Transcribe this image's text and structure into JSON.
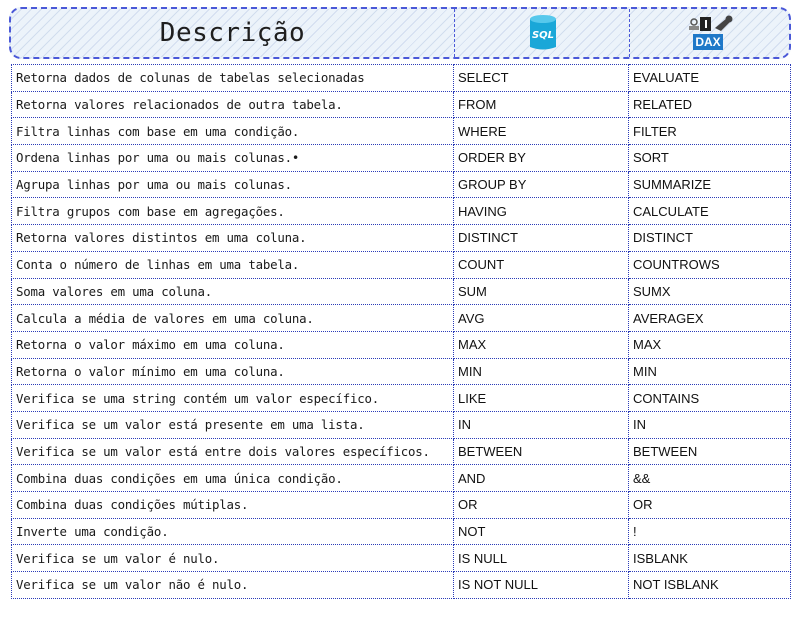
{
  "header": {
    "title": "Descrição",
    "sql_logo_text": "SQL",
    "dax_logo_text": "DAX"
  },
  "rows": [
    {
      "desc": "Retorna dados de colunas de tabelas selecionadas",
      "sql": "SELECT",
      "dax": "EVALUATE"
    },
    {
      "desc": "Retorna valores relacionados de outra tabela.",
      "sql": "FROM",
      "dax": "RELATED"
    },
    {
      "desc": "Filtra linhas com base em uma condição.",
      "sql": "WHERE",
      "dax": "FILTER"
    },
    {
      "desc": "Ordena linhas por uma ou mais colunas.•",
      "sql": "ORDER BY",
      "dax": "SORT"
    },
    {
      "desc": "Agrupa linhas por uma ou mais colunas.",
      "sql": "GROUP BY",
      "dax": "SUMMARIZE"
    },
    {
      "desc": "Filtra grupos com base em agregações.",
      "sql": "HAVING",
      "dax": "CALCULATE"
    },
    {
      "desc": "Retorna valores distintos em uma coluna.",
      "sql": "DISTINCT",
      "dax": "DISTINCT"
    },
    {
      "desc": "Conta o número de linhas em uma tabela.",
      "sql": "COUNT",
      "dax": "COUNTROWS"
    },
    {
      "desc": "Soma valores em uma coluna.",
      "sql": "SUM",
      "dax": "SUMX"
    },
    {
      "desc": "Calcula a média de valores em uma coluna.",
      "sql": "AVG",
      "dax": "AVERAGEX"
    },
    {
      "desc": "Retorna o valor máximo em uma coluna.",
      "sql": "MAX",
      "dax": "MAX"
    },
    {
      "desc": "Retorna o valor mínimo em uma coluna.",
      "sql": "MIN",
      "dax": "MIN"
    },
    {
      "desc": "Verifica se uma string contém um valor específico.",
      "sql": "LIKE",
      "dax": "CONTAINS"
    },
    {
      "desc": "Verifica se um valor está presente em uma lista.",
      "sql": "IN",
      "dax": "IN"
    },
    {
      "desc": "Verifica se um valor está entre dois valores específicos.",
      "sql": "BETWEEN",
      "dax": "BETWEEN"
    },
    {
      "desc": "Combina duas condições em uma única condição.",
      "sql": "AND",
      "dax": "&&"
    },
    {
      "desc": "Combina duas condições mútiplas.",
      "sql": "OR",
      "dax": "OR"
    },
    {
      "desc": "Inverte uma condição.",
      "sql": "NOT",
      "dax": "!"
    },
    {
      "desc": "Verifica se um valor é nulo.",
      "sql": "IS NULL",
      "dax": "ISBLANK"
    },
    {
      "desc": "Verifica se um valor não é nulo.",
      "sql": "IS NOT NULL",
      "dax": "NOT ISBLANK"
    }
  ],
  "colors": {
    "border": "#2b3bb8",
    "header_border": "#4a58d8",
    "header_bg": "#ecf3fa",
    "sql_logo": "#1aa7d8",
    "dax_logo": "#1f78c8"
  },
  "icons": {
    "sql": "sql-database-icon",
    "dax": "dax-wrench-icon"
  }
}
